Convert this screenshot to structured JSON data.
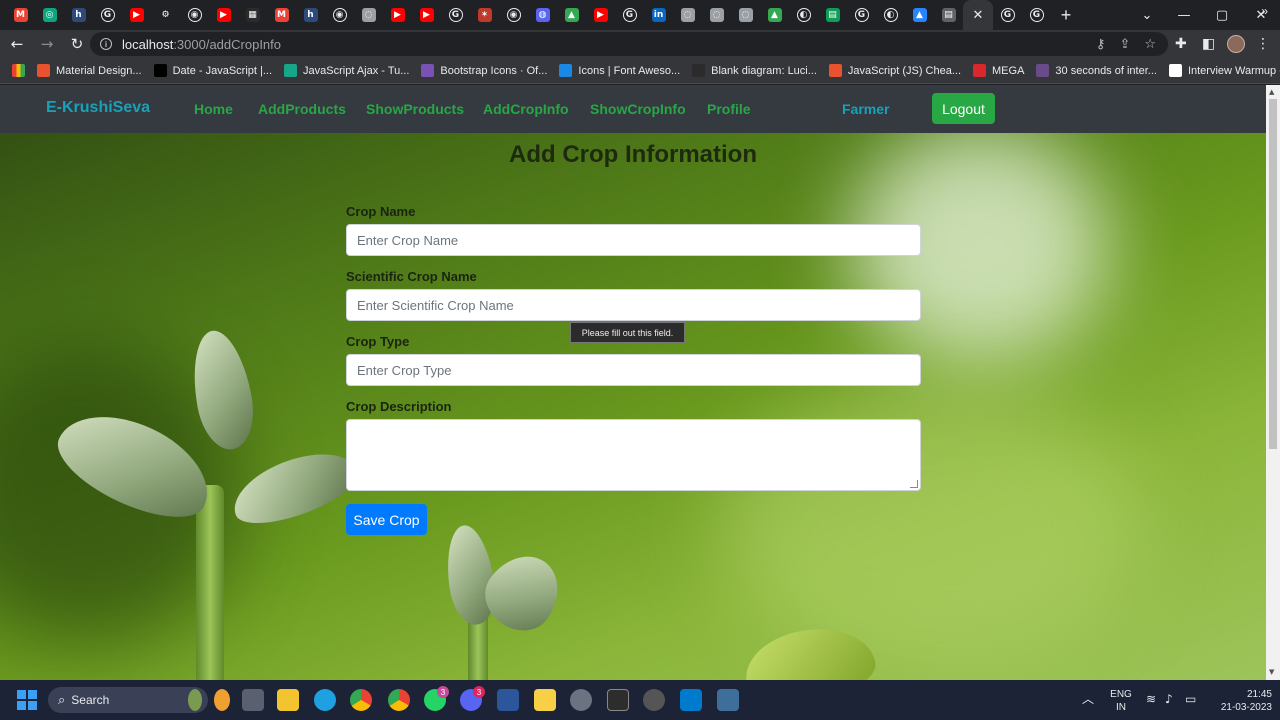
{
  "browser": {
    "tabs": [
      {
        "icon": "gmail-icon",
        "color": "#ea4335",
        "glyph": "M"
      },
      {
        "icon": "chatgpt-icon",
        "color": "#10a37f",
        "glyph": "◎"
      },
      {
        "icon": "hashnode-icon",
        "color": "#2c4a7a",
        "glyph": "h"
      },
      {
        "icon": "google-icon",
        "color": "#ffffff",
        "glyph": "G"
      },
      {
        "icon": "youtube-icon",
        "color": "#ff0000",
        "glyph": "▶"
      },
      {
        "icon": "settings-icon",
        "color": "#202124",
        "glyph": "⚙"
      },
      {
        "icon": "chrome-icon",
        "color": "#ffffff",
        "glyph": "◉"
      },
      {
        "icon": "youtube-icon",
        "color": "#ff0000",
        "glyph": "▶"
      },
      {
        "icon": "spreadsheet-icon",
        "color": "#2b2b2b",
        "glyph": "▦"
      },
      {
        "icon": "gmail-icon",
        "color": "#ea4335",
        "glyph": "M"
      },
      {
        "icon": "hashnode-icon",
        "color": "#2c4a7a",
        "glyph": "h"
      },
      {
        "icon": "chrome-icon",
        "color": "#ffffff",
        "glyph": "◉"
      },
      {
        "icon": "web-icon",
        "color": "#9aa0a6",
        "glyph": "◌"
      },
      {
        "icon": "youtube-icon",
        "color": "#ff0000",
        "glyph": "▶"
      },
      {
        "icon": "youtube-icon",
        "color": "#ff0000",
        "glyph": "▶"
      },
      {
        "icon": "google-icon",
        "color": "#ffffff",
        "glyph": "G"
      },
      {
        "icon": "feather-icon",
        "color": "#c0392b",
        "glyph": "✶"
      },
      {
        "icon": "chrome-icon",
        "color": "#ffffff",
        "glyph": "◉"
      },
      {
        "icon": "discord-icon",
        "color": "#5865f2",
        "glyph": "◍"
      },
      {
        "icon": "drive-icon",
        "color": "#34a853",
        "glyph": "▲"
      },
      {
        "icon": "youtube-icon",
        "color": "#ff0000",
        "glyph": "▶"
      },
      {
        "icon": "google-icon",
        "color": "#ffffff",
        "glyph": "G"
      },
      {
        "icon": "linkedin-icon",
        "color": "#0a66c2",
        "glyph": "in"
      },
      {
        "icon": "web-icon",
        "color": "#9aa0a6",
        "glyph": "◌"
      },
      {
        "icon": "web-icon",
        "color": "#9aa0a6",
        "glyph": "◌"
      },
      {
        "icon": "web-icon",
        "color": "#9aa0a6",
        "glyph": "◌"
      },
      {
        "icon": "drive-icon",
        "color": "#34a853",
        "glyph": "▲"
      },
      {
        "icon": "github-icon",
        "color": "#ffffff",
        "glyph": "◐"
      },
      {
        "icon": "sheets-icon",
        "color": "#0f9d58",
        "glyph": "▤"
      },
      {
        "icon": "google-icon",
        "color": "#ffffff",
        "glyph": "G"
      },
      {
        "icon": "github-icon",
        "color": "#ffffff",
        "glyph": "◐"
      },
      {
        "icon": "atlassian-icon",
        "color": "#2684ff",
        "glyph": "▲"
      },
      {
        "icon": "document-icon",
        "color": "#5f6368",
        "glyph": "▤"
      }
    ],
    "after_tabs": [
      {
        "icon": "google-icon",
        "color": "#ffffff",
        "glyph": "G"
      },
      {
        "icon": "google-icon",
        "color": "#ffffff",
        "glyph": "G"
      }
    ],
    "url_host": "localhost",
    "url_path": ":3000/addCropInfo",
    "bookmarks": [
      {
        "label": "Material Design...",
        "color": "#e8532f"
      },
      {
        "label": "Date - JavaScript |...",
        "color": "#000000"
      },
      {
        "label": "JavaScript Ajax - Tu...",
        "color": "#18a689"
      },
      {
        "label": "Bootstrap Icons · Of...",
        "color": "#7952b3"
      },
      {
        "label": "Icons | Font Aweso...",
        "color": "#1c88e6"
      },
      {
        "label": "Blank diagram: Luci...",
        "color": "#2b2b2b"
      },
      {
        "label": "JavaScript (JS) Chea...",
        "color": "#e8532f"
      },
      {
        "label": "MEGA",
        "color": "#d9272e"
      },
      {
        "label": "30 seconds of inter...",
        "color": "#6a4b8a"
      },
      {
        "label": "Interview Warmup -...",
        "color": "#ffffff"
      }
    ]
  },
  "app": {
    "brand": "E-KrushiSeva",
    "nav": [
      "Home",
      "AddProducts",
      "ShowProducts",
      "AddCropInfo",
      "ShowCropInfo",
      "Profile"
    ],
    "role": "Farmer",
    "logout": "Logout",
    "title": "Add Crop Information",
    "form": {
      "crop_name_label": "Crop Name",
      "crop_name_placeholder": "Enter Crop Name",
      "sci_name_label": "Scientific Crop Name",
      "sci_name_placeholder": "Enter Scientific Crop Name",
      "crop_type_label": "Crop Type",
      "crop_type_placeholder": "Enter Crop Type",
      "desc_label": "Crop Description",
      "save": "Save Crop"
    },
    "tooltip": "Please fill out this field."
  },
  "taskbar": {
    "search": "Search",
    "lang1": "ENG",
    "lang2": "IN",
    "time": "21:45",
    "date": "21-03-2023",
    "badge_whatsapp": "3",
    "badge_discord": "3"
  }
}
